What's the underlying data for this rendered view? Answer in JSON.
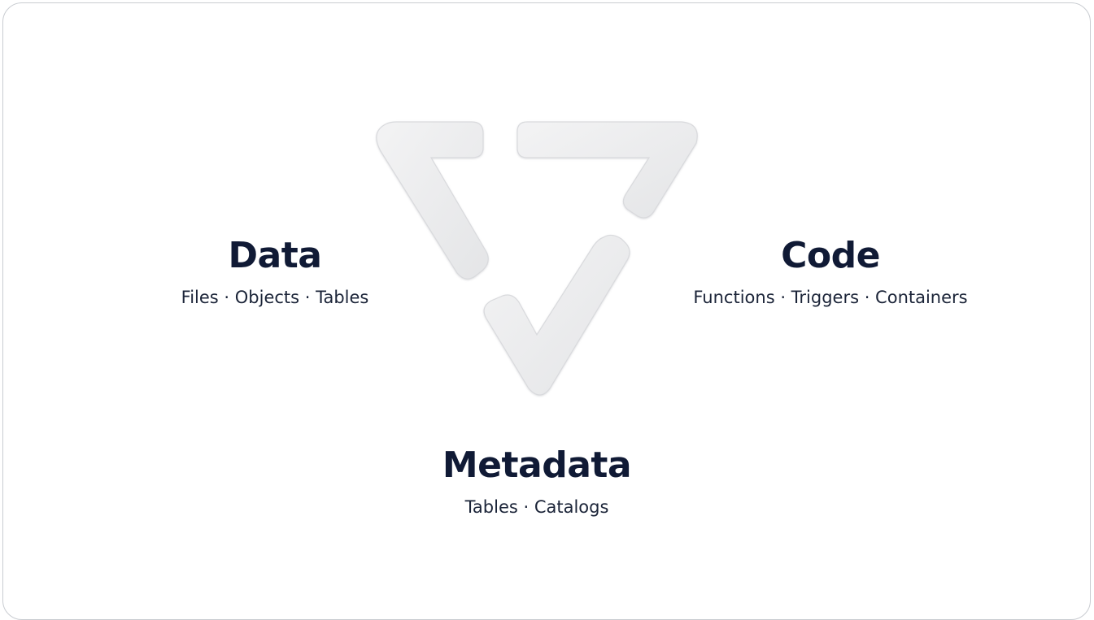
{
  "diagram": {
    "nodes": [
      {
        "id": "data",
        "title": "Data",
        "subtitle": "Files · Objects · Tables"
      },
      {
        "id": "code",
        "title": "Code",
        "subtitle": "Functions · Triggers · Containers"
      },
      {
        "id": "metadata",
        "title": "Metadata",
        "subtitle": "Tables · Catalogs"
      }
    ]
  },
  "colors": {
    "title_text": "#101a35",
    "subtitle_text": "#1b2438",
    "logo_fill": "#ececee",
    "card_border": "#c9ccd1"
  },
  "icons": {
    "logo": "triangle-chevron-logo-icon"
  }
}
